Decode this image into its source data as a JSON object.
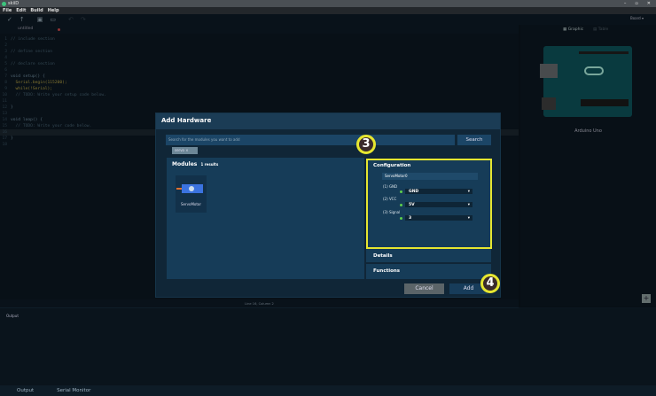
{
  "app": {
    "title": "skiiD",
    "menu": [
      "File",
      "Edit",
      "Build",
      "Help"
    ]
  },
  "editor": {
    "tab": "untitled",
    "lines": [
      {
        "n": "1",
        "t": "// include section",
        "c": "cm"
      },
      {
        "n": "2",
        "t": "",
        "c": ""
      },
      {
        "n": "3",
        "t": "// define section",
        "c": "cm"
      },
      {
        "n": "4",
        "t": "",
        "c": ""
      },
      {
        "n": "5",
        "t": "// declare section",
        "c": "cm"
      },
      {
        "n": "6",
        "t": "",
        "c": ""
      },
      {
        "n": "7",
        "t": "void setup() {",
        "c": "kw"
      },
      {
        "n": "8",
        "t": "  Serial.begin(115200);",
        "c": "fn"
      },
      {
        "n": "9",
        "t": "  while(!Serial);",
        "c": "fn"
      },
      {
        "n": "10",
        "t": "  // TODO: Write your setup code below.",
        "c": "cm"
      },
      {
        "n": "11",
        "t": "",
        "c": ""
      },
      {
        "n": "12",
        "t": "}",
        "c": "kw"
      },
      {
        "n": "13",
        "t": "",
        "c": ""
      },
      {
        "n": "14",
        "t": "void loop() {",
        "c": "kw"
      },
      {
        "n": "15",
        "t": "  // TODO: Write your code below.",
        "c": "cm"
      },
      {
        "n": "16",
        "t": "",
        "c": ""
      },
      {
        "n": "17",
        "t": "}",
        "c": "kw"
      },
      {
        "n": "18",
        "t": "",
        "c": ""
      }
    ],
    "status": "Line 16, Column 2"
  },
  "right": {
    "board_select": "Board",
    "tab_graphic": "Graphic",
    "tab_table": "Table",
    "board_name": "Arduino Uno"
  },
  "output": {
    "label": "Output",
    "tabs": [
      "Output",
      "Serial Monitor"
    ]
  },
  "modal": {
    "title": "Add Hardware",
    "search_placeholder": "Search for the modules you want to add",
    "search_button": "Search",
    "tag": "servo",
    "modules_title": "Modules",
    "results": "1 results",
    "module_name": "ServoMotor",
    "config": {
      "title": "Configuration",
      "instance": "ServoMotor0",
      "pins": [
        {
          "label": "(1) GND",
          "value": "GND"
        },
        {
          "label": "(2) VCC",
          "value": "5V"
        },
        {
          "label": "(3) Signal",
          "value": "3"
        }
      ]
    },
    "details": "Details",
    "functions": "Functions",
    "cancel": "Cancel",
    "add": "Add"
  },
  "annotations": {
    "step3": "3",
    "step4": "4",
    "color": "#e6e630"
  }
}
